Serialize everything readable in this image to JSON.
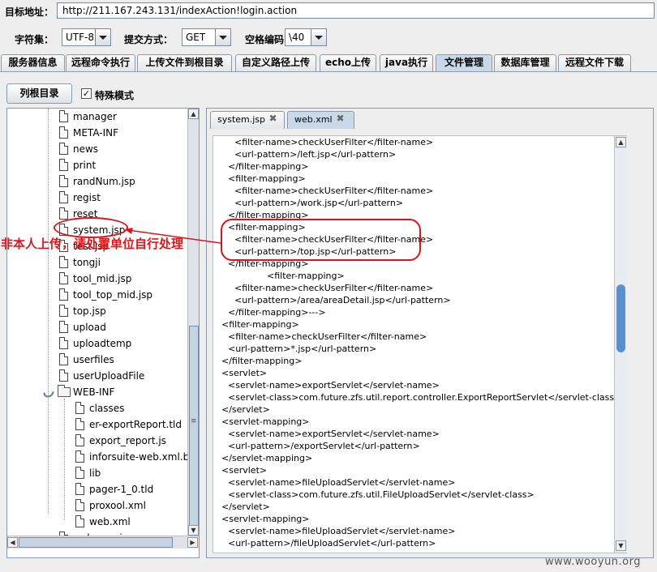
{
  "toolbar": {
    "target_label": "目标地址：",
    "target_url": "http://211.167.243.131/indexAction!login.action",
    "charset_label": "字符集：",
    "charset_value": "UTF-8",
    "method_label": "提交方式：",
    "method_value": "GET",
    "space_label": "空格编码",
    "space_value": "\\40"
  },
  "tabs": [
    {
      "label": "服务器信息"
    },
    {
      "label": "远程命令执行"
    },
    {
      "label": "上传文件到根目录"
    },
    {
      "label": "自定义路径上传"
    },
    {
      "label": "echo上传"
    },
    {
      "label": "java执行"
    },
    {
      "label": "文件管理"
    },
    {
      "label": "数据库管理"
    },
    {
      "label": "远程文件下载"
    }
  ],
  "active_tab": "文件管理",
  "controls": {
    "list_root_label": "列根目录",
    "special_mode_label": "特殊模式",
    "special_mode_checked": true,
    "check_glyph": "✓"
  },
  "tree_items": [
    {
      "label": "manager",
      "type": "file",
      "depth": 1
    },
    {
      "label": "META-INF",
      "type": "file",
      "depth": 1
    },
    {
      "label": "news",
      "type": "file",
      "depth": 1
    },
    {
      "label": "print",
      "type": "file",
      "depth": 1
    },
    {
      "label": "randNum.jsp",
      "type": "file",
      "depth": 1
    },
    {
      "label": "regist",
      "type": "file",
      "depth": 1
    },
    {
      "label": "reset",
      "type": "file",
      "depth": 1
    },
    {
      "label": "system.jsp",
      "type": "file",
      "depth": 1
    },
    {
      "label": "test.jsp",
      "type": "file",
      "depth": 1
    },
    {
      "label": "tongji",
      "type": "file",
      "depth": 1
    },
    {
      "label": "tool_mid.jsp",
      "type": "file",
      "depth": 1
    },
    {
      "label": "tool_top_mid.jsp",
      "type": "file",
      "depth": 1
    },
    {
      "label": "top.jsp",
      "type": "file",
      "depth": 1
    },
    {
      "label": "upload",
      "type": "file",
      "depth": 1
    },
    {
      "label": "uploadtemp",
      "type": "file",
      "depth": 1
    },
    {
      "label": "userfiles",
      "type": "file",
      "depth": 1
    },
    {
      "label": "userUploadFile",
      "type": "file",
      "depth": 1
    },
    {
      "label": "WEB-INF",
      "type": "folder",
      "depth": 1
    },
    {
      "label": "classes",
      "type": "file",
      "depth": 2
    },
    {
      "label": "er-exportReport.tld",
      "type": "file",
      "depth": 2
    },
    {
      "label": "export_report.js",
      "type": "file",
      "depth": 2
    },
    {
      "label": "inforsuite-web.xml.bak",
      "type": "file",
      "depth": 2
    },
    {
      "label": "lib",
      "type": "file",
      "depth": 2
    },
    {
      "label": "pager-1_0.tld",
      "type": "file",
      "depth": 2
    },
    {
      "label": "proxool.xml",
      "type": "file",
      "depth": 2
    },
    {
      "label": "web.xml",
      "type": "file",
      "depth": 2
    },
    {
      "label": "welcome.jsp",
      "type": "file",
      "depth": 1
    }
  ],
  "editor_tabs": [
    {
      "label": "system.jsp",
      "close": "✖"
    },
    {
      "label": "web.xml",
      "close": "✖"
    }
  ],
  "active_editor_tab": "web.xml",
  "code_lines": [
    {
      "text": "<filter-name>checkUserFilter</filter-name>",
      "indent": 2
    },
    {
      "text": "<url-pattern>/left.jsp</url-pattern>",
      "indent": 2
    },
    {
      "text": "</filter-mapping>",
      "indent": 1
    },
    {
      "text": "<filter-mapping>",
      "indent": 1
    },
    {
      "text": "<filter-name>checkUserFilter</filter-name>",
      "indent": 2
    },
    {
      "text": "<url-pattern>/work.jsp</url-pattern>",
      "indent": 2
    },
    {
      "text": "</filter-mapping>",
      "indent": 1
    },
    {
      "text": "<filter-mapping>",
      "indent": 1
    },
    {
      "text": "<filter-name>checkUserFilter</filter-name>",
      "indent": 2
    },
    {
      "text": "<url-pattern>/top.jsp</url-pattern>",
      "indent": 2
    },
    {
      "text": "</filter-mapping>",
      "indent": 1
    },
    {
      "text": "<filter-mapping>",
      "indent": 7
    },
    {
      "text": "<filter-name>checkUserFilter</filter-name>",
      "indent": 2
    },
    {
      "text": "<url-pattern>/area/areaDetail.jsp</url-pattern>",
      "indent": 2
    },
    {
      "text": "</filter-mapping>--->",
      "indent": 1
    },
    {
      "text": "<filter-mapping>",
      "indent": 0
    },
    {
      "text": "<filter-name>checkUserFilter</filter-name>",
      "indent": 1
    },
    {
      "text": "<url-pattern>*.jsp</url-pattern>",
      "indent": 1
    },
    {
      "text": "</filter-mapping>",
      "indent": 0
    },
    {
      "text": "<servlet>",
      "indent": 0
    },
    {
      "text": "<servlet-name>exportServlet</servlet-name>",
      "indent": 1
    },
    {
      "text": "<servlet-class>com.future.zfs.util.report.controller.ExportReportServlet</servlet-class>",
      "indent": 1
    },
    {
      "text": "</servlet>",
      "indent": 0
    },
    {
      "text": "<servlet-mapping>",
      "indent": 0
    },
    {
      "text": "<servlet-name>exportServlet</servlet-name>",
      "indent": 1
    },
    {
      "text": "<url-pattern>/exportServlet</url-pattern>",
      "indent": 1
    },
    {
      "text": "</servlet-mapping>",
      "indent": 0
    },
    {
      "text": "<servlet>",
      "indent": 0
    },
    {
      "text": "<servlet-name>fileUploadServlet</servlet-name>",
      "indent": 1
    },
    {
      "text": "<servlet-class>com.future.zfs.util.FileUploadServlet</servlet-class>",
      "indent": 1
    },
    {
      "text": "</servlet>",
      "indent": 0
    },
    {
      "text": "<servlet-mapping>",
      "indent": 0
    },
    {
      "text": "<servlet-name>fileUploadServlet</servlet-name>",
      "indent": 1
    },
    {
      "text": "<url-pattern>/fileUploadServlet</url-pattern>",
      "indent": 1
    }
  ],
  "annotation": {
    "text": "非本人上传，请处置单位自行处理",
    "color": "#e0141a"
  },
  "watermark": "www.wooyun.org",
  "icons": {
    "scroll_up": "▲",
    "scroll_down": "▼",
    "scroll_left": "◀",
    "scroll_right": "▶",
    "grip": "≡"
  },
  "colors": {
    "active_tab_bg": "#c9d9ea",
    "scroll_thumb": "#5a8fd0",
    "annotation_red": "#d9141a"
  }
}
